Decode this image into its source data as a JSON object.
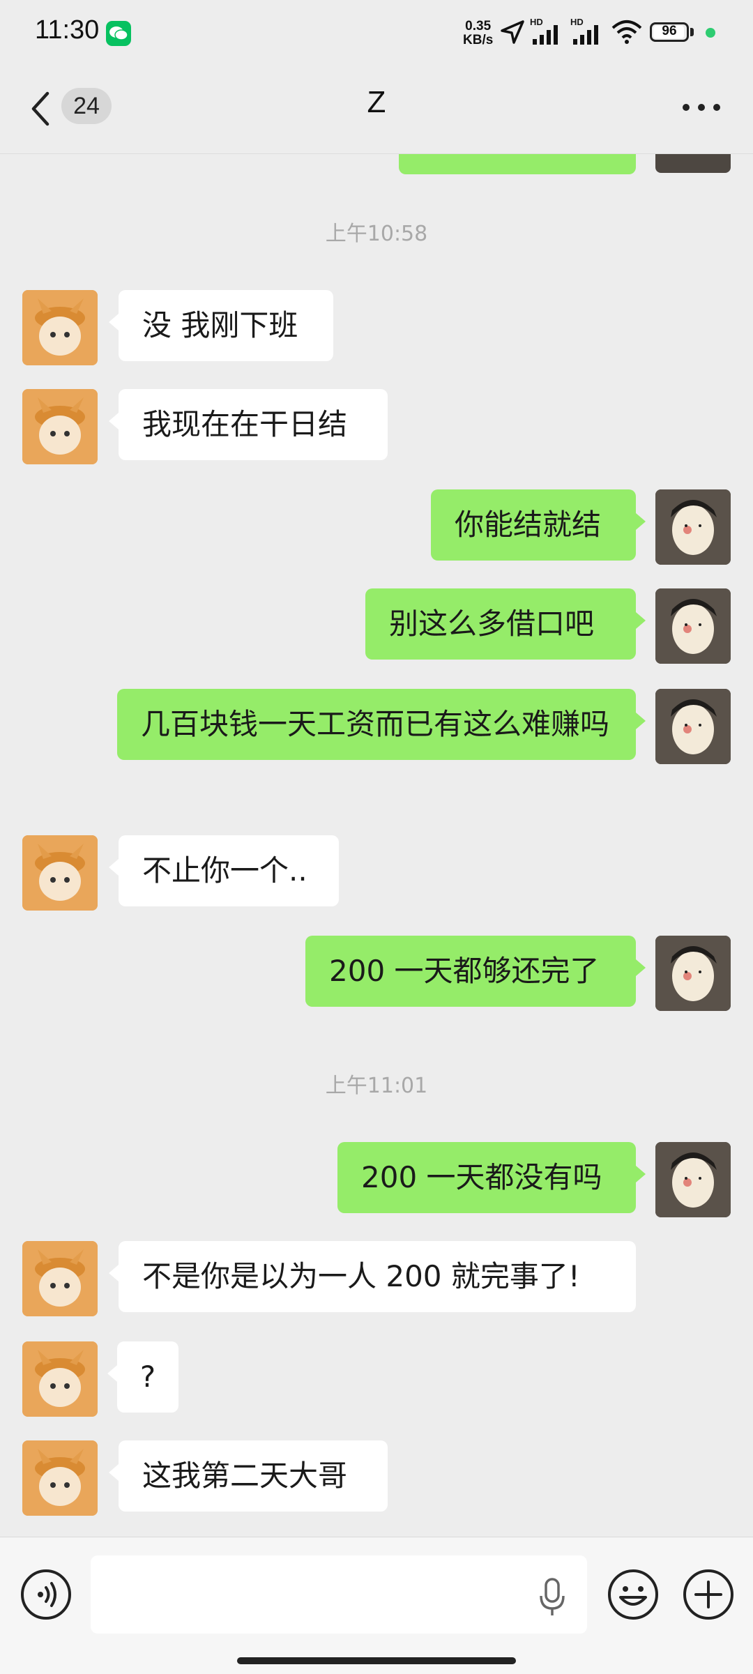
{
  "status_bar": {
    "time": "11:30",
    "net_speed_value": "0.35",
    "net_speed_unit": "KB/s",
    "signal_1_label": "HD",
    "signal_2_label": "HD",
    "battery": "96",
    "battery_fraction": 0.96
  },
  "header": {
    "unread_count": "24",
    "title": "Z"
  },
  "messages": [
    {
      "type": "time",
      "text": "上午10:58"
    },
    {
      "type": "in",
      "text": "没 我刚下班"
    },
    {
      "type": "in",
      "text": "我现在在干日结"
    },
    {
      "type": "out",
      "text": "你能结就结"
    },
    {
      "type": "out",
      "text": "别这么多借口吧"
    },
    {
      "type": "out",
      "text": "几百块钱一天工资而已有这么难赚吗"
    },
    {
      "type": "in",
      "text": "不止你一个.."
    },
    {
      "type": "out",
      "text": "200 一天都够还完了"
    },
    {
      "type": "time",
      "text": "上午11:01"
    },
    {
      "type": "out",
      "text": "200 一天都没有吗"
    },
    {
      "type": "in",
      "text": "不是你是以为一人 200 就完事了!"
    },
    {
      "type": "in",
      "text": "?"
    },
    {
      "type": "in",
      "text": "这我第二天大哥"
    }
  ],
  "input": {
    "placeholder": ""
  },
  "colors": {
    "outgoing_bubble": "#95ec69",
    "incoming_bubble": "#ffffff",
    "background": "#ededed"
  }
}
